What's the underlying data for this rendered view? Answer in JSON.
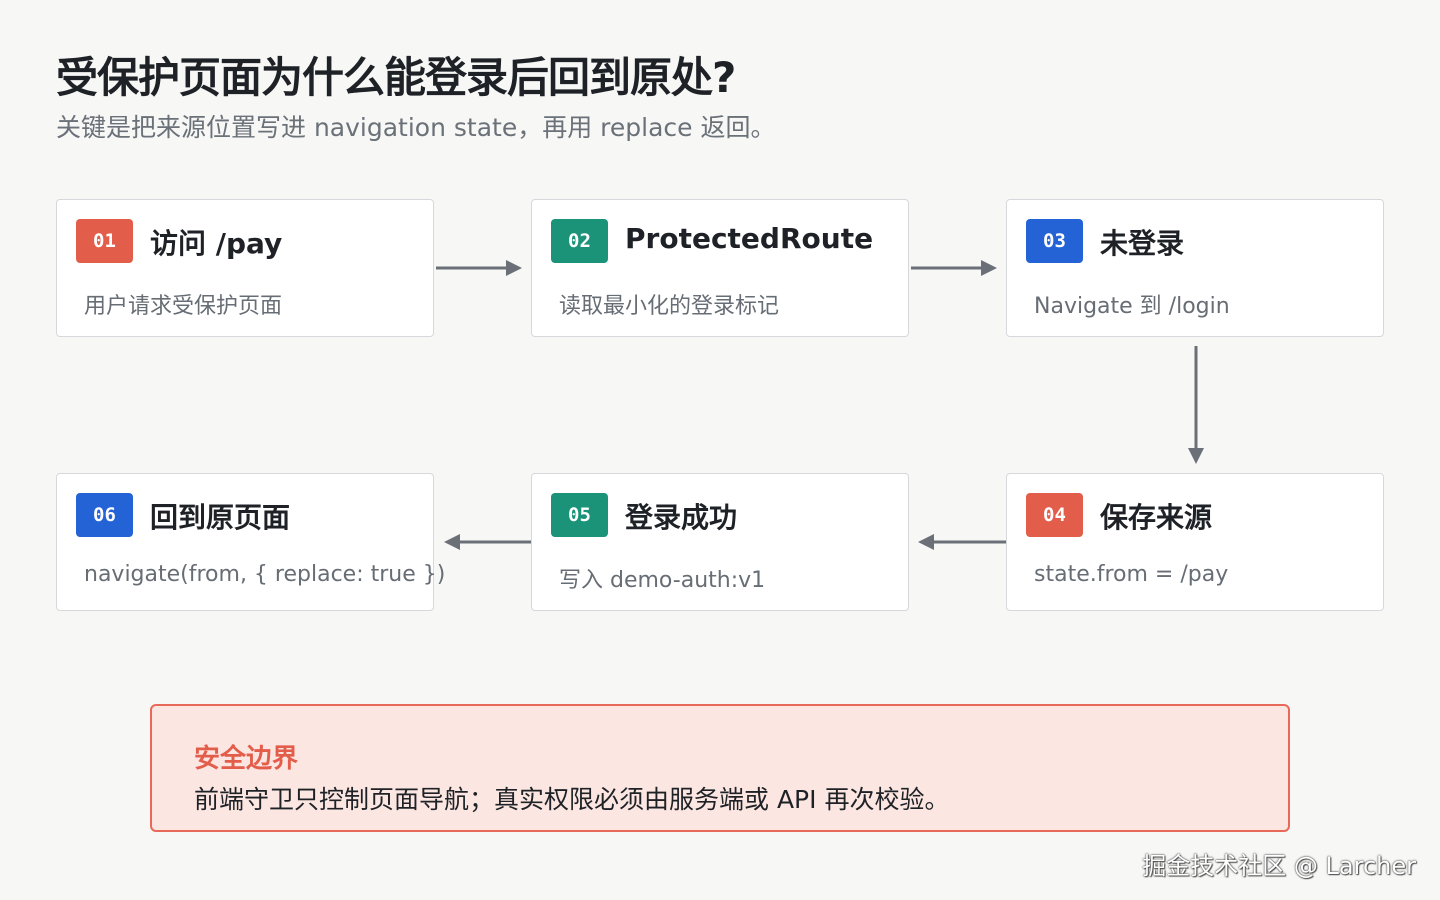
{
  "header": {
    "title": "受保护页面为什么能登录后回到原处?",
    "subtitle": "关键是把来源位置写进 navigation state，再用 replace 返回。"
  },
  "steps": [
    {
      "num": "01",
      "title": "访问 /pay",
      "desc": "用户请求受保护页面",
      "color": "#e35d4b"
    },
    {
      "num": "02",
      "title": "ProtectedRoute",
      "desc": "读取最小化的登录标记",
      "color": "#1a9379"
    },
    {
      "num": "03",
      "title": "未登录",
      "desc": "Navigate 到 /login",
      "color": "#2463d6"
    },
    {
      "num": "04",
      "title": "保存来源",
      "desc": "state.from = /pay",
      "color": "#e35d4b"
    },
    {
      "num": "05",
      "title": "登录成功",
      "desc": "写入 demo-auth:v1",
      "color": "#1a9379"
    },
    {
      "num": "06",
      "title": "回到原页面",
      "desc": "navigate(from, { replace: true })",
      "color": "#2463d6"
    }
  ],
  "callout": {
    "title": "安全边界",
    "text": "前端守卫只控制页面导航；真实权限必须由服务端或 API 再次校验。"
  },
  "watermark": "掘金技术社区 @ Larcher",
  "colors": {
    "arrow": "#6b7078",
    "callout_border": "#e8695a",
    "callout_bg": "#fce6e2"
  }
}
